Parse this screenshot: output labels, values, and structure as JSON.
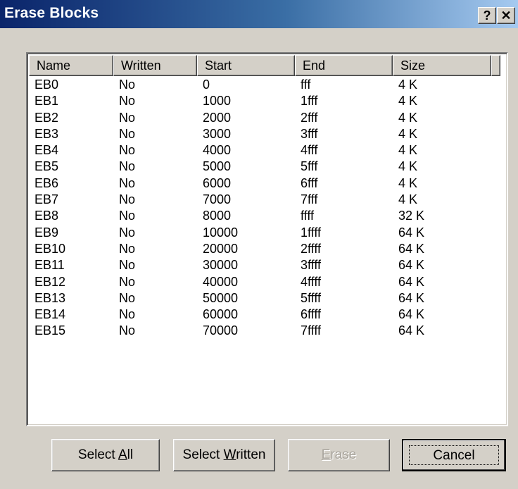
{
  "window": {
    "title": "Erase Blocks",
    "help_label": "?",
    "close_label": "✕"
  },
  "list": {
    "columns": [
      "Name",
      "Written",
      "Start",
      "End",
      "Size"
    ],
    "rows": [
      [
        "EB0",
        "No",
        "0",
        "fff",
        "4 K"
      ],
      [
        "EB1",
        "No",
        "1000",
        "1fff",
        "4 K"
      ],
      [
        "EB2",
        "No",
        "2000",
        "2fff",
        "4 K"
      ],
      [
        "EB3",
        "No",
        "3000",
        "3fff",
        "4 K"
      ],
      [
        "EB4",
        "No",
        "4000",
        "4fff",
        "4 K"
      ],
      [
        "EB5",
        "No",
        "5000",
        "5fff",
        "4 K"
      ],
      [
        "EB6",
        "No",
        "6000",
        "6fff",
        "4 K"
      ],
      [
        "EB7",
        "No",
        "7000",
        "7fff",
        "4 K"
      ],
      [
        "EB8",
        "No",
        "8000",
        "ffff",
        "32 K"
      ],
      [
        "EB9",
        "No",
        "10000",
        "1ffff",
        "64 K"
      ],
      [
        "EB10",
        "No",
        "20000",
        "2ffff",
        "64 K"
      ],
      [
        "EB11",
        "No",
        "30000",
        "3ffff",
        "64 K"
      ],
      [
        "EB12",
        "No",
        "40000",
        "4ffff",
        "64 K"
      ],
      [
        "EB13",
        "No",
        "50000",
        "5ffff",
        "64 K"
      ],
      [
        "EB14",
        "No",
        "60000",
        "6ffff",
        "64 K"
      ],
      [
        "EB15",
        "No",
        "70000",
        "7ffff",
        "64 K"
      ]
    ]
  },
  "buttons": {
    "select_all": {
      "pre": "Select ",
      "mnemonic": "A",
      "post": "ll"
    },
    "select_written": {
      "pre": "Select ",
      "mnemonic": "W",
      "post": "ritten"
    },
    "erase": {
      "pre": "",
      "mnemonic": "E",
      "post": "rase",
      "disabled": true
    },
    "cancel": {
      "label": "Cancel"
    }
  }
}
